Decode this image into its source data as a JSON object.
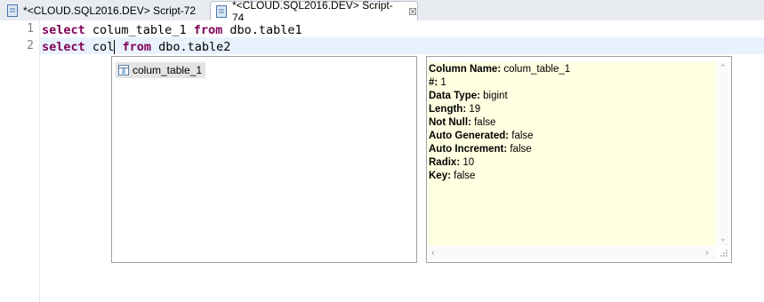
{
  "tabs": [
    {
      "label": "*<CLOUD.SQL2016.DEV> Script-72",
      "icon": "sql-script-icon"
    },
    {
      "label": "*<CLOUD.SQL2016.DEV> Script-74",
      "icon": "sql-script-icon",
      "close": "☒"
    }
  ],
  "editor": {
    "lines": [
      {
        "number": "1",
        "kw1": "select",
        "mid1": " colum_table_1 ",
        "kw2": "from",
        "tail": " dbo.table1"
      },
      {
        "number": "2",
        "kw1": "select",
        "mid1a": " col",
        "mid1b": " ",
        "kw2": "from",
        "tail": " dbo.table2"
      }
    ]
  },
  "autocomplete": {
    "items": [
      {
        "label": "colum_table_1",
        "icon": "column-icon"
      }
    ]
  },
  "info": {
    "rows": [
      {
        "key": "Column Name:",
        "value": " colum_table_1"
      },
      {
        "key": "#:",
        "value": " 1"
      },
      {
        "key": "Data Type:",
        "value": " bigint"
      },
      {
        "key": "Length:",
        "value": " 19"
      },
      {
        "key": "Not Null:",
        "value": " false"
      },
      {
        "key": "Auto Generated:",
        "value": " false"
      },
      {
        "key": "Auto Increment:",
        "value": " false"
      },
      {
        "key": "Radix:",
        "value": " 10"
      },
      {
        "key": "Key:",
        "value": " false"
      }
    ]
  },
  "colors": {
    "keyword": "#7f0055",
    "current_line": "#e8f2fe",
    "info_bg": "#ffffe1"
  }
}
